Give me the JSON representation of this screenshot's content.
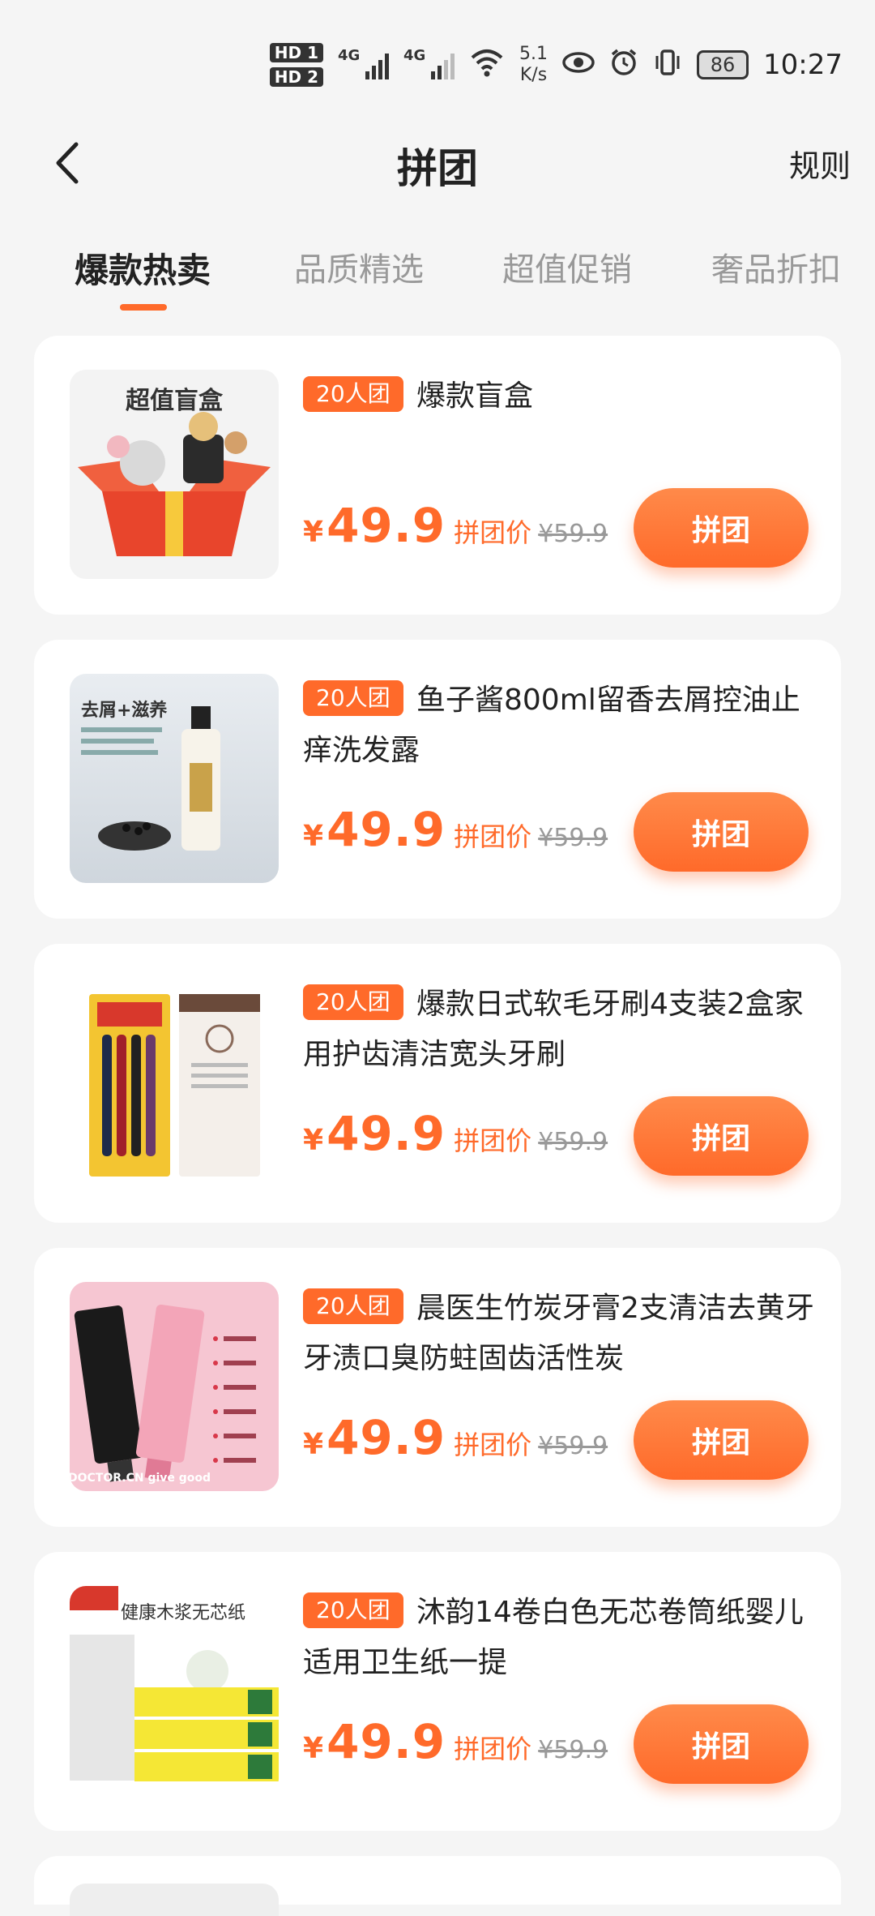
{
  "status_bar": {
    "hd1": "HD 1",
    "hd2": "HD 2",
    "net1": "4G",
    "net2": "4G",
    "wifi_label": "6⁺",
    "speed_value": "5.1",
    "speed_unit": "K/s",
    "battery": "86",
    "time": "10:27",
    "icons": [
      "eye-icon",
      "alarm-icon",
      "vibrate-icon"
    ]
  },
  "header": {
    "title": "拼团",
    "rules": "规则"
  },
  "tabs": [
    {
      "label": "爆款热卖",
      "active": true
    },
    {
      "label": "品质精选",
      "active": false
    },
    {
      "label": "超值促销",
      "active": false
    },
    {
      "label": "奢品折扣",
      "active": false
    }
  ],
  "products": [
    {
      "badge": "20人团",
      "name": "爆款盲盒",
      "yen": "¥",
      "price": "49.9",
      "price_label": "拼团价",
      "orig_price": "¥59.9",
      "button": "拼团",
      "thumb_text": "超值盲盒"
    },
    {
      "badge": "20人团",
      "name": "鱼子酱800ml留香去屑控油止痒洗发露",
      "yen": "¥",
      "price": "49.9",
      "price_label": "拼团价",
      "orig_price": "¥59.9",
      "button": "拼团",
      "thumb_text": "去屑+滋养"
    },
    {
      "badge": "20人团",
      "name": "爆款日式软毛牙刷4支装2盒家用护齿清洁宽头牙刷",
      "yen": "¥",
      "price": "49.9",
      "price_label": "拼团价",
      "orig_price": "¥59.9",
      "button": "拼团",
      "thumb_text": ""
    },
    {
      "badge": "20人团",
      "name": "晨医生竹炭牙膏2支清洁去黄牙牙渍口臭防蛀固齿活性炭",
      "yen": "¥",
      "price": "49.9",
      "price_label": "拼团价",
      "orig_price": "¥59.9",
      "button": "拼团",
      "thumb_text": "DOCTOR.CN give good"
    },
    {
      "badge": "20人团",
      "name": "沐韵14卷白色无芯卷筒纸婴儿适用卫生纸一提",
      "yen": "¥",
      "price": "49.9",
      "price_label": "拼团价",
      "orig_price": "¥59.9",
      "button": "拼团",
      "thumb_text": "健康木浆无芯纸"
    }
  ],
  "colors": {
    "accent": "#ff6a2a",
    "background": "#f5f5f5",
    "card": "#ffffff"
  }
}
